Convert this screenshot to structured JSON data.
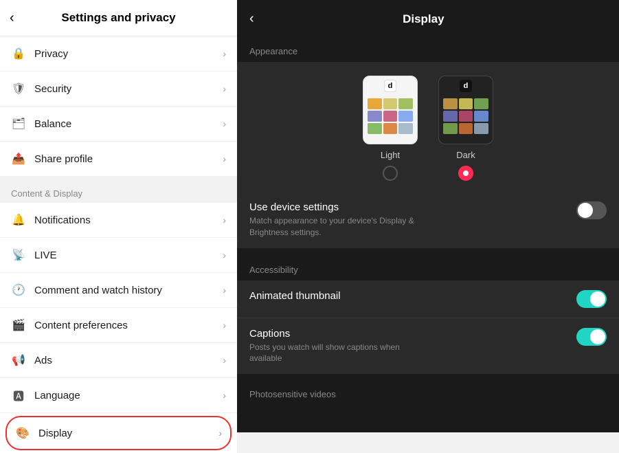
{
  "left": {
    "header": {
      "title": "Settings and privacy",
      "back_label": "‹"
    },
    "section1": {
      "items": [
        {
          "id": "privacy",
          "label": "Privacy",
          "icon": "🔒"
        },
        {
          "id": "security",
          "label": "Security",
          "icon": "🛡"
        },
        {
          "id": "balance",
          "label": "Balance",
          "icon": "🗂"
        },
        {
          "id": "share-profile",
          "label": "Share profile",
          "icon": "📤"
        }
      ]
    },
    "section2_label": "Content & Display",
    "section2": {
      "items": [
        {
          "id": "notifications",
          "label": "Notifications",
          "icon": "🔔"
        },
        {
          "id": "live",
          "label": "LIVE",
          "icon": "📡"
        },
        {
          "id": "comment-watch-history",
          "label": "Comment and watch history",
          "icon": "🕐"
        },
        {
          "id": "content-preferences",
          "label": "Content preferences",
          "icon": "🎬"
        },
        {
          "id": "ads",
          "label": "Ads",
          "icon": "📢"
        },
        {
          "id": "language",
          "label": "Language",
          "icon": "🅰"
        },
        {
          "id": "display",
          "label": "Display",
          "icon": "🎨",
          "highlighted": true
        }
      ]
    }
  },
  "right": {
    "header": {
      "title": "Display",
      "back_label": "‹"
    },
    "appearance_label": "Appearance",
    "themes": [
      {
        "id": "light",
        "name": "Light",
        "selected": false,
        "grid_colors": [
          "#e8a838",
          "#d4c870",
          "#a0c060",
          "#8888cc",
          "#cc6688",
          "#88aaee",
          "#88bb66",
          "#dd8844",
          "#aabbcc",
          "#9988dd"
        ]
      },
      {
        "id": "dark",
        "name": "Dark",
        "selected": true,
        "grid_colors": [
          "#b89040",
          "#c4b855",
          "#70a050",
          "#6666aa",
          "#aa4466",
          "#6688cc",
          "#70994a",
          "#bb6630",
          "#8899aa",
          "#7766bb"
        ]
      }
    ],
    "use_device_settings": {
      "title": "Use device settings",
      "desc": "Match appearance to your device's Display & Brightness settings.",
      "enabled": false
    },
    "accessibility_label": "Accessibility",
    "toggles": [
      {
        "id": "animated-thumbnail",
        "title": "Animated thumbnail",
        "desc": "",
        "enabled": true
      },
      {
        "id": "captions",
        "title": "Captions",
        "desc": "Posts you watch will show captions when available",
        "enabled": true
      }
    ],
    "photosensitive_label": "Photosensitive videos"
  }
}
